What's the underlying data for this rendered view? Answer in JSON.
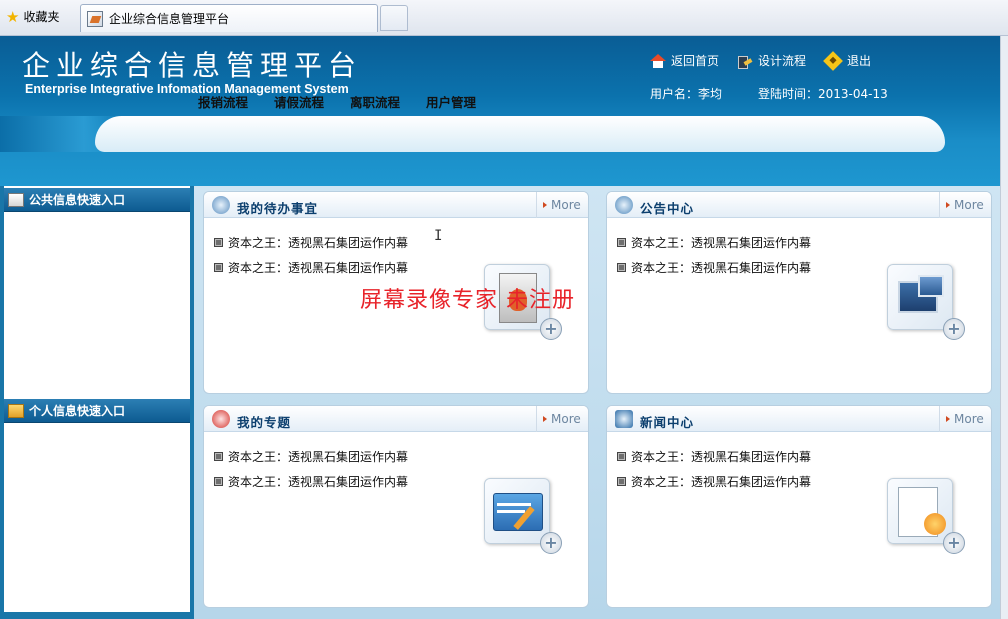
{
  "browser": {
    "favorites_label": "收藏夹",
    "tab_title": "企业综合信息管理平台"
  },
  "header": {
    "title_cn": "企业综合信息管理平台",
    "title_en": "Enterprise Integrative Infomation Management System",
    "links": [
      {
        "label": "返回首页",
        "icon": "home-icon"
      },
      {
        "label": "设计流程",
        "icon": "design-flow-icon"
      },
      {
        "label": "退出",
        "icon": "exit-icon"
      }
    ],
    "username_text": "用户名：李均",
    "login_time_text": "登陆时间：2013-04-13"
  },
  "nav": {
    "items": [
      "报销流程",
      "请假流程",
      "离职流程",
      "用户管理"
    ]
  },
  "sidebar": {
    "public_title": "公共信息快速入口",
    "personal_title": "个人信息快速入口"
  },
  "panels": [
    {
      "title": "我的待办事宜",
      "more": "More",
      "items": [
        "资本之王：透视黑石集团运作内幕",
        "资本之王：透视黑石集团运作内幕"
      ]
    },
    {
      "title": "公告中心",
      "more": "More",
      "items": [
        "资本之王：透视黑石集团运作内幕",
        "资本之王：透视黑石集团运作内幕"
      ]
    },
    {
      "title": "我的专题",
      "more": "More",
      "items": [
        "资本之王：透视黑石集团运作内幕",
        "资本之王：透视黑石集团运作内幕"
      ]
    },
    {
      "title": "新闻中心",
      "more": "More",
      "items": [
        "资本之王：透视黑石集团运作内幕",
        "资本之王：透视黑石集团运作内幕"
      ]
    }
  ],
  "watermark": "屏幕录像专家 未注册",
  "colors": {
    "header_blue": "#0b72ad",
    "title_blue": "#0c3f6e",
    "watermark_red": "#e8232a"
  }
}
